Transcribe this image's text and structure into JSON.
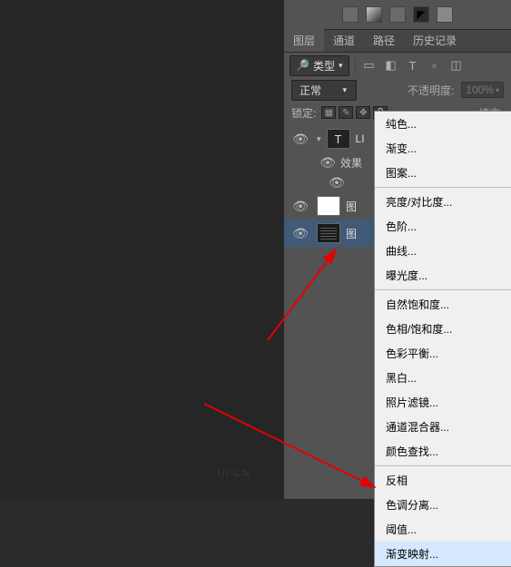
{
  "toolbar": {
    "icons": [
      "box",
      "gradient",
      "box",
      "arrow",
      "gray"
    ]
  },
  "panelTabs": {
    "active": "图层",
    "others": [
      "通道",
      "路径",
      "历史记录"
    ]
  },
  "filter": {
    "label": "类型"
  },
  "filterIcons": [
    "▭",
    "◧",
    "T",
    "▫",
    "◫"
  ],
  "blend": {
    "mode": "正常",
    "opacityLabel": "不透明度:",
    "opacityValue": "100%"
  },
  "lock": {
    "label": "锁定:",
    "fillLabel": "填充:"
  },
  "layers": {
    "text": {
      "name": "LI"
    },
    "effects": {
      "label": "效果"
    },
    "layer2": {
      "name": "图"
    },
    "layer3": {
      "name": "图"
    }
  },
  "contextMenu": {
    "g1": [
      "纯色...",
      "渐变...",
      "图案..."
    ],
    "g2": [
      "亮度/对比度...",
      "色阶...",
      "曲线...",
      "曝光度..."
    ],
    "g3": [
      "自然饱和度...",
      "色相/饱和度...",
      "色彩平衡...",
      "黑白...",
      "照片滤镜...",
      "通道混合器...",
      "颜色查找..."
    ],
    "g4": [
      "反相",
      "色调分离...",
      "阈值...",
      "渐变映射..."
    ]
  },
  "watermark": "UI·CN"
}
